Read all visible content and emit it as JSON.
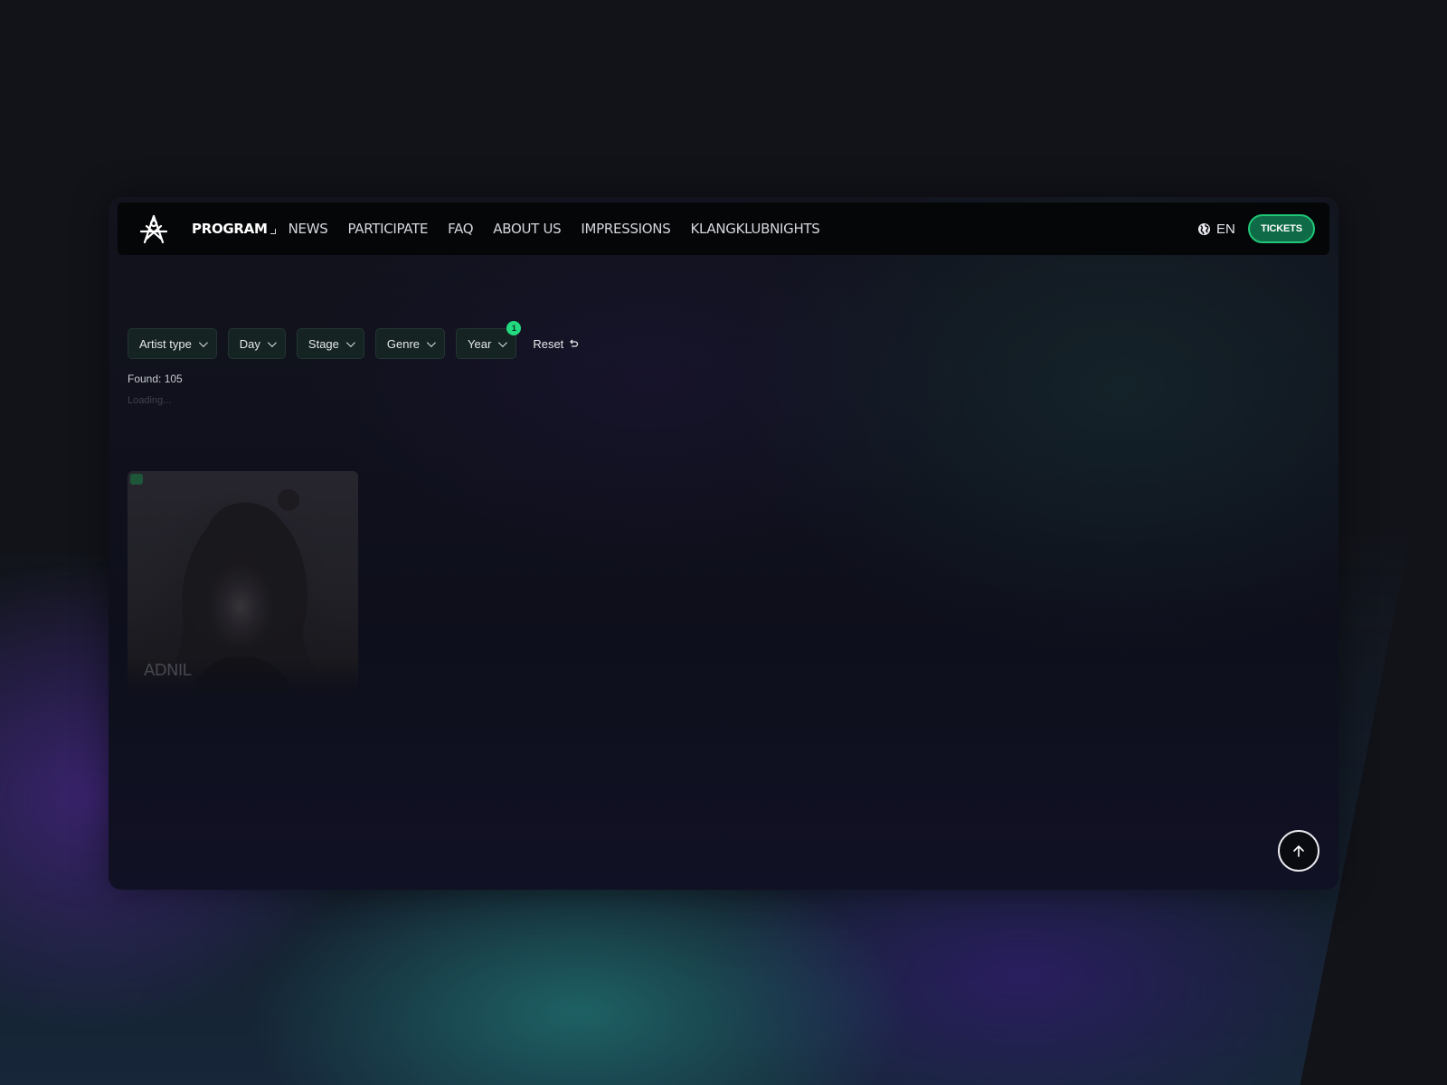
{
  "nav": {
    "logo_icon": "festival-logo-icon",
    "items": [
      {
        "label": "PROGRAM",
        "active": true
      },
      {
        "label": "NEWS"
      },
      {
        "label": "PARTICIPATE"
      },
      {
        "label": "FAQ"
      },
      {
        "label": "ABOUT US"
      },
      {
        "label": "IMPRESSIONS"
      },
      {
        "label": "KLANGKLUBNIGHTS"
      }
    ],
    "language": "EN",
    "language_icon": "globe-icon",
    "tickets_label": "TICKETS"
  },
  "filters": {
    "items": [
      {
        "label": "Artist type"
      },
      {
        "label": "Day"
      },
      {
        "label": "Stage"
      },
      {
        "label": "Genre"
      },
      {
        "label": "Year",
        "badge": "1"
      }
    ],
    "reset_label": "Reset",
    "reset_icon": "undo-icon"
  },
  "results": {
    "found": "Found: 105",
    "loading": "Loading..."
  },
  "cards": [
    {
      "name": "ADNIL"
    }
  ],
  "scroll_top_icon": "arrow-up-icon",
  "colors": {
    "accent": "#22d97f",
    "tickets_bg": "#0f6b47",
    "background": "#121319"
  }
}
